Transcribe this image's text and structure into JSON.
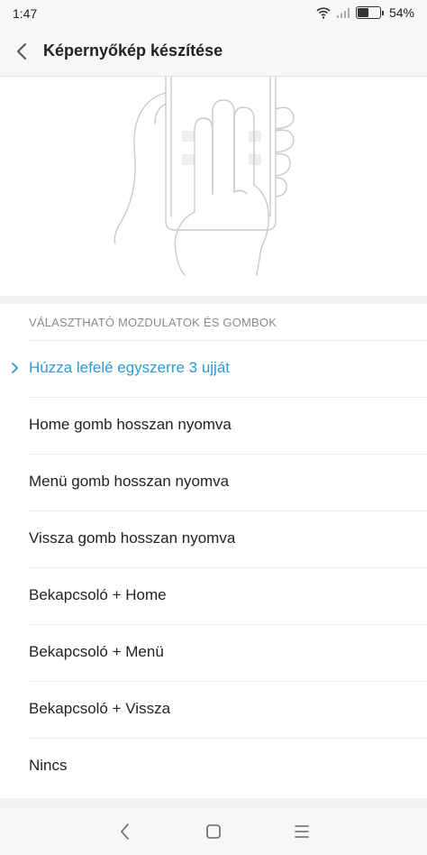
{
  "status_bar": {
    "time": "1:47",
    "battery_percent": "54%",
    "battery_level": 0.54,
    "icons": [
      "wifi-icon",
      "signal-icon",
      "battery-icon"
    ]
  },
  "header": {
    "title": "Képernyőkép készítése",
    "back_icon": "chevron-left-icon"
  },
  "illustration": {
    "description_icon": "three-finger-swipe-illustration"
  },
  "options": {
    "section_title": "VÁLASZTHATÓ MOZDULATOK ÉS GOMBOK",
    "items": [
      {
        "label": "Húzza lefelé egyszerre 3 ujját",
        "selected": true
      },
      {
        "label": "Home gomb hosszan nyomva",
        "selected": false
      },
      {
        "label": "Menü gomb hosszan nyomva",
        "selected": false
      },
      {
        "label": "Vissza gomb hosszan nyomva",
        "selected": false
      },
      {
        "label": "Bekapcsoló + Home",
        "selected": false
      },
      {
        "label": "Bekapcsoló + Menü",
        "selected": false
      },
      {
        "label": "Bekapcsoló + Vissza",
        "selected": false
      },
      {
        "label": "Nincs",
        "selected": false
      }
    ],
    "accent_color": "#2e9ad6"
  },
  "nav_bar": {
    "icons": [
      "back-nav-icon",
      "home-nav-icon",
      "menu-nav-icon"
    ]
  }
}
